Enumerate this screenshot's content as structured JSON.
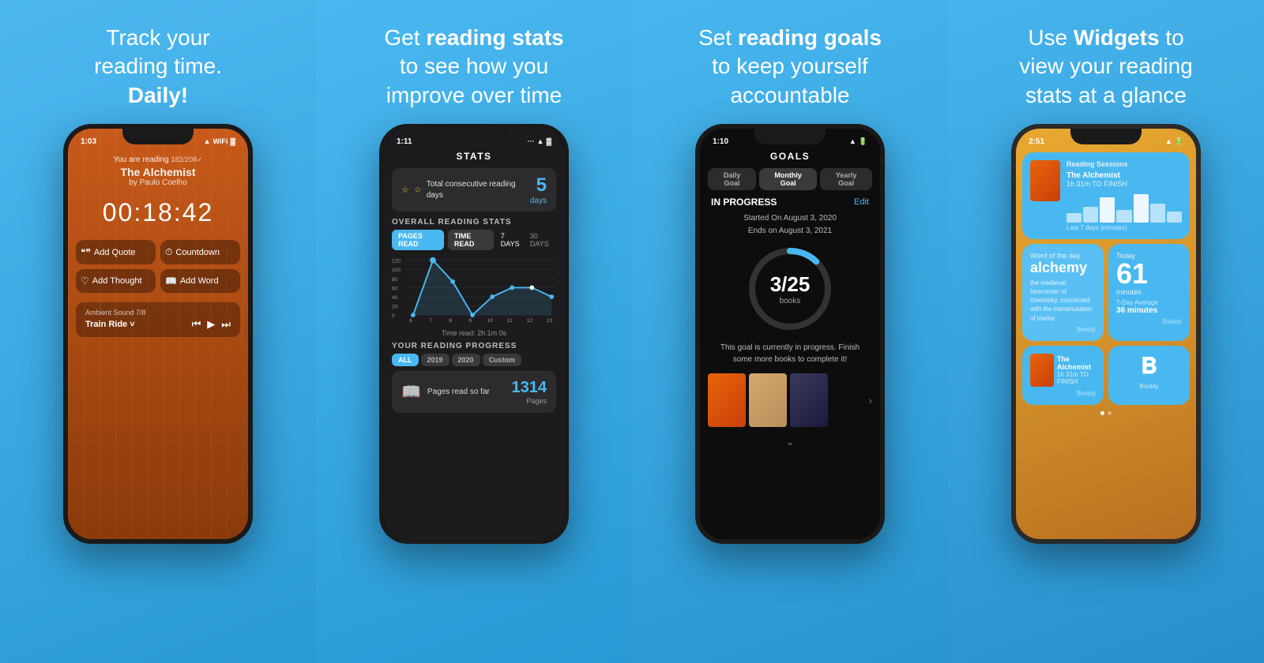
{
  "panels": [
    {
      "id": "track",
      "heading_line1": "Track your",
      "heading_line2": "reading time.",
      "heading_bold": "Daily!",
      "phone": {
        "time": "1:03",
        "screen": "track",
        "book_reading_label": "You are reading",
        "book_pages": "182/208✓",
        "book_title": "The Alchemist",
        "book_author": "by Paulo Coelho",
        "timer": "00:18:42",
        "buttons": [
          {
            "icon": "❝",
            "label": "Add Quote"
          },
          {
            "icon": "⏱",
            "label": "Countdown"
          },
          {
            "icon": "♡",
            "label": "Add Thought"
          },
          {
            "icon": "📖",
            "label": "Add Word"
          }
        ],
        "ambient_label": "Ambient Sound 7/8",
        "track_name": "Train Ride ˅"
      }
    },
    {
      "id": "stats",
      "heading": "Get reading stats to see how you improve over time",
      "phone": {
        "time": "1:11",
        "screen": "stats",
        "screen_title": "STATS",
        "consecutive_label": "Total consecutive reading days",
        "consecutive_num": "5",
        "consecutive_unit": "days",
        "overall_title": "OVERALL READING STATS",
        "tabs": [
          "PAGES READ",
          "TIME READ"
        ],
        "days_tabs": [
          "7 DAYS",
          "30 DAYS"
        ],
        "chart_labels": [
          "6",
          "7",
          "8",
          "9",
          "10",
          "11",
          "12",
          "13"
        ],
        "chart_y_labels": [
          "120",
          "100",
          "80",
          "60",
          "40",
          "20",
          "0"
        ],
        "time_label": "Time read: 2h 1m 0s",
        "progress_title": "YOUR READING PROGRESS",
        "progress_tabs": [
          "ALL",
          "2019",
          "2020",
          "Custom"
        ],
        "pages_icon": "📖",
        "pages_label": "Pages read so far",
        "pages_num": "1314",
        "pages_unit": "Pages"
      }
    },
    {
      "id": "goals",
      "heading": "Set reading goals to keep yourself accountable",
      "phone": {
        "time": "1:10",
        "screen": "goals",
        "screen_title": "GOALS",
        "goal_tabs": [
          "Daily Goal",
          "Monthly Goal",
          "Yearly Goal"
        ],
        "active_tab": "Monthly Goal",
        "in_progress": "IN PROGRESS",
        "edit": "Edit",
        "started": "Started On August 3, 2020",
        "ends": "Ends on August 3, 2021",
        "goal_current": "3",
        "goal_total": "25",
        "goal_unit": "books",
        "goal_message": "This goal is currently in progress. Finish some more books to complete it!"
      }
    },
    {
      "id": "widgets",
      "heading_line1": "Use",
      "heading_bold": "Widgets",
      "heading_line2": "to view your reading stats at a glance",
      "phone": {
        "time": "2:51",
        "screen": "widgets",
        "widget1_title": "Reading Sessions",
        "widget1_book": "The Alchemist",
        "widget1_time": "1h 31m TO FINISH",
        "widget1_chart_label": "Last 7 days (minutes)",
        "widget2_word_label": "Word of the day",
        "widget2_word": "alchemy",
        "widget2_def": "the medieval forerunner of chemistry, concerned with the transmutation of matter",
        "widget2_bookly": "Bookly",
        "widget3_label": "Today",
        "widget3_num": "61",
        "widget3_unit": "minutes",
        "widget3_avg_label": "7-Day Average",
        "widget3_avg": "36 minutes",
        "widget3_bookly": "Bookly",
        "widget4_book": "The Alchemist",
        "widget4_time": "1h 31m TO FINISH",
        "widget4_bookly": "Bookly",
        "widget5_bookly": "Bookly"
      }
    }
  ]
}
